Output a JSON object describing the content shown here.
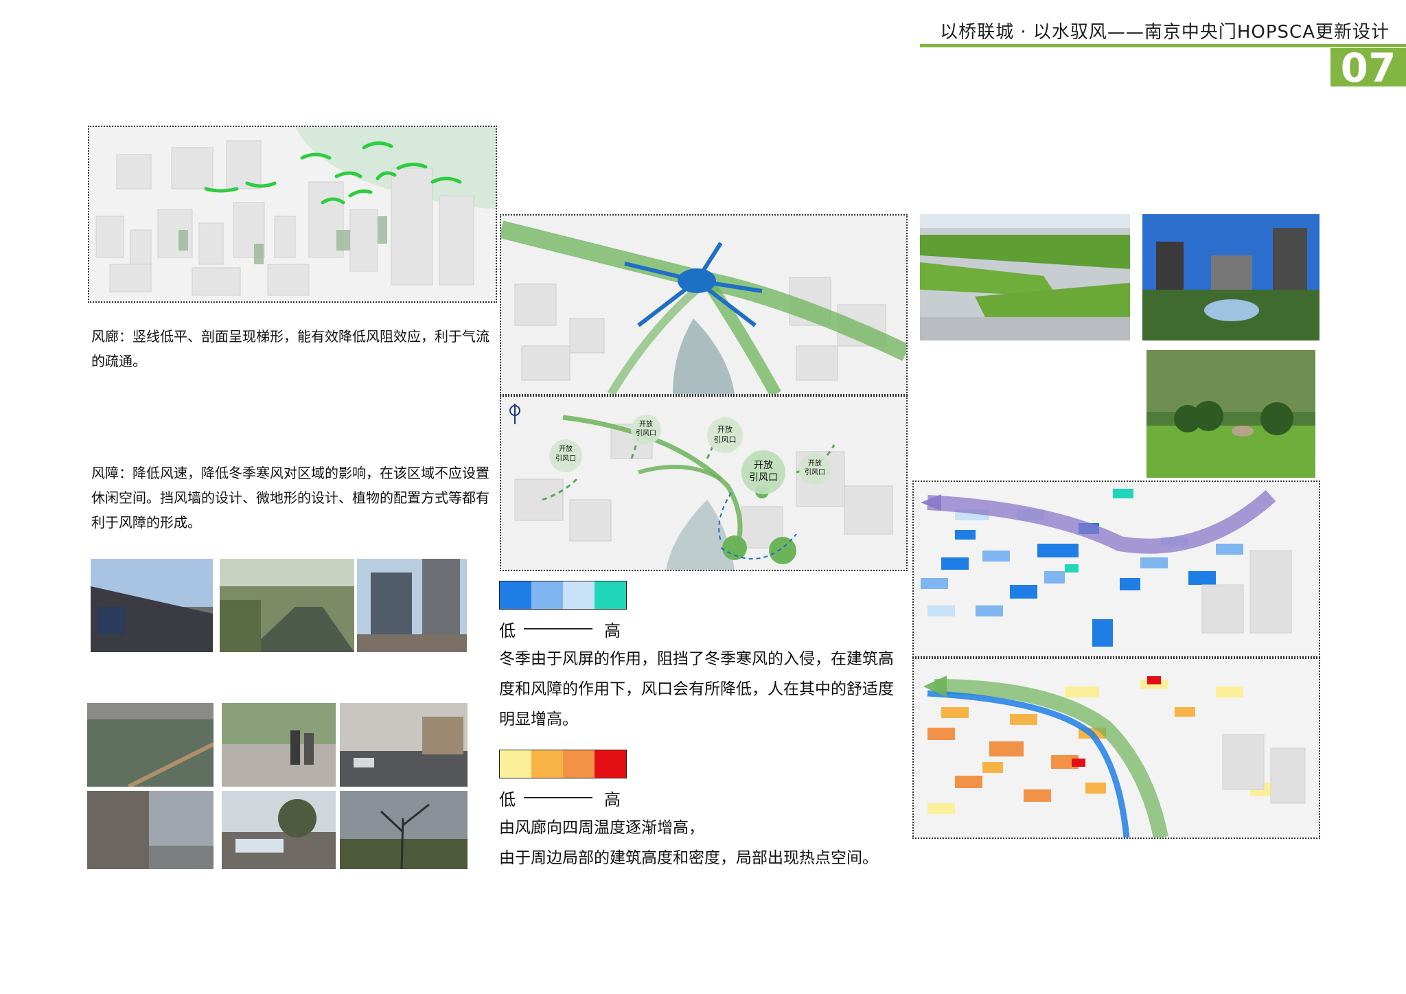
{
  "header": {
    "title": "以桥联城 · 以水驭风——南京中央门HOPSCA更新设计",
    "page_number": "07"
  },
  "wind_corridor": {
    "text": "风廊：竖线低平、剖面呈现梯形，能有效降低风阻效应，利于气流的疏通。"
  },
  "wind_barrier": {
    "text": "风障：降低风速，降低冬季寒风对区域的影响，在该区域不应设置休闲空间。挡风墙的设计、微地形的设计、植物的配置方式等都有利于风障的形成。"
  },
  "map_labels": {
    "open_inlet_a": [
      "开放",
      "引风口"
    ],
    "open_inlet_b": [
      "开放",
      "引风口"
    ],
    "open_inlet_c": [
      "开放",
      "引风口"
    ],
    "open_inlet_d": [
      "开放",
      "引风口"
    ],
    "open_inlet_main": [
      "开放",
      "引风口"
    ]
  },
  "legend_wind": {
    "colors": [
      "#1e7ee6",
      "#7fb5f0",
      "#c8e2f7",
      "#1fd6b9"
    ],
    "low": "低",
    "high": "高"
  },
  "winter_text": "冬季由于风屏的作用，阻挡了冬季寒风的入侵，在建筑高度和风障的作用下，风口会有所降低，人在其中的舒适度明显增高。",
  "legend_temp": {
    "colors": [
      "#fcef9a",
      "#f8b347",
      "#f29247",
      "#e30f15"
    ],
    "low": "低",
    "high": "高"
  },
  "temp_text_1": "由风廊向四周温度逐渐增高，",
  "temp_text_2": "由于周边局部的建筑高度和密度，局部出现热点空间。",
  "colors": {
    "accent_green": "#82b541",
    "corridor_green": "#6db35a",
    "wind_blue": "#1e6fc6",
    "purple_flow": "#8a78c8"
  }
}
